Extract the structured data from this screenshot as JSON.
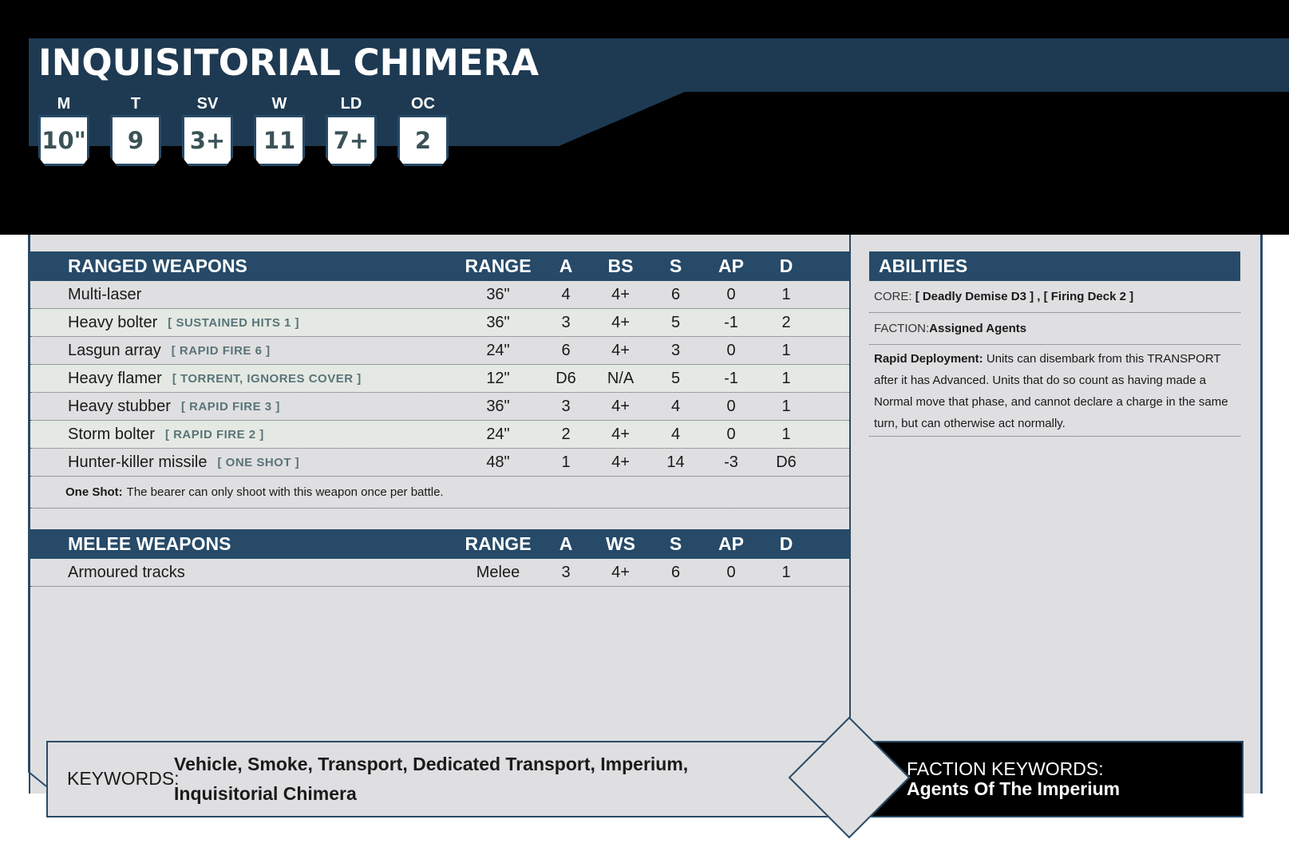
{
  "unit": {
    "name": "INQUISITORIAL CHIMERA",
    "stats": [
      {
        "label": "M",
        "value": "10\""
      },
      {
        "label": "T",
        "value": "9"
      },
      {
        "label": "SV",
        "value": "3+"
      },
      {
        "label": "W",
        "value": "11"
      },
      {
        "label": "LD",
        "value": "7+"
      },
      {
        "label": "OC",
        "value": "2"
      }
    ]
  },
  "ranged": {
    "headers": [
      "RANGED WEAPONS",
      "RANGE",
      "A",
      "BS",
      "S",
      "AP",
      "D"
    ],
    "rows": [
      {
        "name": "Multi-laser",
        "kw": "",
        "range": "36\"",
        "a": "4",
        "bs": "4+",
        "s": "6",
        "ap": "0",
        "d": "1"
      },
      {
        "name": "Heavy bolter",
        "kw": "[ SUSTAINED HITS 1 ]",
        "range": "36\"",
        "a": "3",
        "bs": "4+",
        "s": "5",
        "ap": "-1",
        "d": "2"
      },
      {
        "name": "Lasgun array",
        "kw": "[ RAPID FIRE 6 ]",
        "range": "24\"",
        "a": "6",
        "bs": "4+",
        "s": "3",
        "ap": "0",
        "d": "1"
      },
      {
        "name": "Heavy flamer",
        "kw": "[ TORRENT, IGNORES COVER ]",
        "range": "12\"",
        "a": "D6",
        "bs": "N/A",
        "s": "5",
        "ap": "-1",
        "d": "1"
      },
      {
        "name": "Heavy stubber",
        "kw": "[ RAPID FIRE 3 ]",
        "range": "36\"",
        "a": "3",
        "bs": "4+",
        "s": "4",
        "ap": "0",
        "d": "1"
      },
      {
        "name": "Storm bolter",
        "kw": "[ RAPID FIRE 2 ]",
        "range": "24\"",
        "a": "2",
        "bs": "4+",
        "s": "4",
        "ap": "0",
        "d": "1"
      },
      {
        "name": "Hunter-killer missile",
        "kw": "[ ONE SHOT ]",
        "range": "48\"",
        "a": "1",
        "bs": "4+",
        "s": "14",
        "ap": "-3",
        "d": "D6"
      }
    ],
    "note": {
      "bold": "One Shot:",
      "text": "The bearer can only shoot with this weapon once per battle."
    }
  },
  "melee": {
    "headers": [
      "MELEE WEAPONS",
      "RANGE",
      "A",
      "WS",
      "S",
      "AP",
      "D"
    ],
    "rows": [
      {
        "name": "Armoured tracks",
        "kw": "",
        "range": "Melee",
        "a": "3",
        "bs": "4+",
        "s": "6",
        "ap": "0",
        "d": "1"
      }
    ]
  },
  "abilities": {
    "title": "ABILITIES",
    "core_label": "CORE:",
    "core_value": "[ Deadly Demise D3 ] , [ Firing Deck 2 ]",
    "faction_label": "FACTION:",
    "faction_value": "Assigned Agents",
    "rule_name": "Rapid Deployment:",
    "rule_text": "Units can disembark from this TRANSPORT after it has Advanced. Units that do so count as having made a Normal move that phase, and cannot declare a charge in the same turn, but can otherwise act normally."
  },
  "keywords": {
    "label": "KEYWORDS:",
    "values": "Vehicle, Smoke, Transport, Dedicated Transport, Imperium, Inquisitorial Chimera"
  },
  "faction_keywords": {
    "label": "FACTION KEYWORDS:",
    "value": "Agents Of The Imperium"
  },
  "colors": {
    "header_blue": "#264a68",
    "panel_grey": "#dfdfe1",
    "alt_row": "#e4e9e3",
    "keyword_tag": "#5a7478"
  }
}
